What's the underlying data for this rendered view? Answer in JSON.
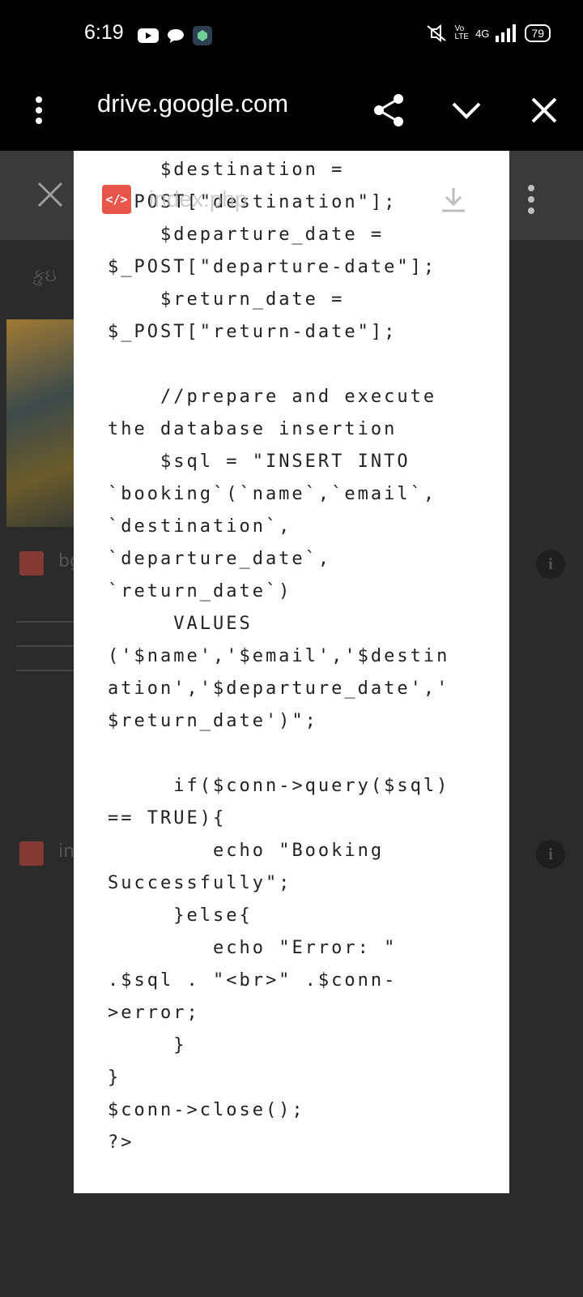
{
  "status_bar": {
    "time": "6:19",
    "icons_left": [
      "youtube-icon",
      "chat-bubble-icon",
      "app-icon"
    ],
    "network": "4G",
    "battery": "79"
  },
  "browser": {
    "url": "drive.google.com",
    "icons": [
      "more-vert-icon",
      "share-icon",
      "chevron-down-icon",
      "close-icon"
    ]
  },
  "viewer": {
    "file_name": "index.php",
    "icons": [
      "close-icon",
      "code-file-icon",
      "download-icon",
      "more-vert-icon"
    ],
    "bg_labels": [
      "કુ઼ઇ",
      "bg",
      "in"
    ]
  },
  "code_text": "    $destination =\n$_POST[\"destination\"];\n    $departure_date =\n$_POST[\"departure-date\"];\n    $return_date =\n$_POST[\"return-date\"];\n\n    //prepare and execute\nthe database insertion\n    $sql = \"INSERT INTO\n`booking`(`name`,`email`,\n`destination`,\n`departure_date`,\n`return_date`)\n     VALUES\n('$name','$email','$destin\nation','$departure_date','\n$return_date')\";\n\n     if($conn->query($sql)\n== TRUE){\n        echo \"Booking\nSuccessfully\";\n     }else{\n        echo \"Error: \"\n.$sql . \"<br>\" .$conn-\n>error;\n     }\n}\n$conn->close();\n?>",
  "colors": {
    "accent_red": "#e8554a",
    "sheet_bg": "#ffffff",
    "backdrop": "#2e2e2e"
  }
}
